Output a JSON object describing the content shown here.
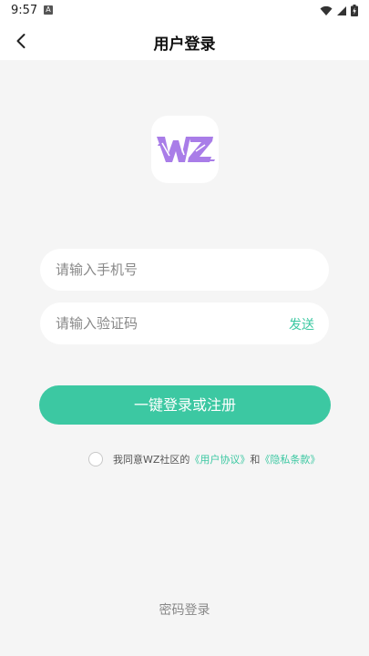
{
  "status_bar": {
    "time": "9:57",
    "notification_letter": "A"
  },
  "header": {
    "title": "用户登录",
    "back_icon": "chevron-left-icon"
  },
  "logo": {
    "text": "WZ",
    "color": "#a97de8"
  },
  "form": {
    "phone_placeholder": "请输入手机号",
    "phone_value": "",
    "code_placeholder": "请输入验证码",
    "code_value": "",
    "send_label": "发送",
    "submit_label": "一键登录或注册"
  },
  "agreement": {
    "prefix": "我同意WZ社区的",
    "user_agreement": "《用户协议》",
    "joiner": "和",
    "privacy_policy": "《隐私条款》",
    "checked": false
  },
  "alt_login": {
    "label": "密码登录"
  },
  "colors": {
    "accent": "#3cc8a2",
    "background": "#f5f5f5",
    "logo_purple": "#a97de8"
  }
}
